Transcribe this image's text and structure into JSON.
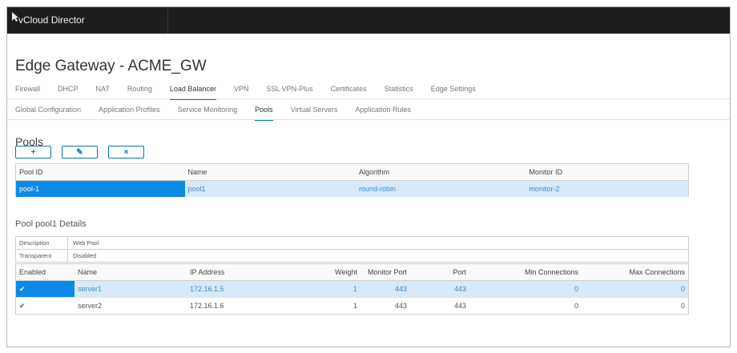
{
  "app": {
    "title": "vCloud Director"
  },
  "page": {
    "title": "Edge Gateway - ACME_GW"
  },
  "tabs": [
    {
      "label": "Firewall",
      "active": false
    },
    {
      "label": "DHCP",
      "active": false
    },
    {
      "label": "NAT",
      "active": false
    },
    {
      "label": "Routing",
      "active": false
    },
    {
      "label": "Load Balancer",
      "active": true
    },
    {
      "label": "VPN",
      "active": false
    },
    {
      "label": "SSL VPN-Plus",
      "active": false
    },
    {
      "label": "Certificates",
      "active": false
    },
    {
      "label": "Statistics",
      "active": false
    },
    {
      "label": "Edge Settings",
      "active": false
    }
  ],
  "subtabs": [
    {
      "label": "Global Configuration",
      "active": false
    },
    {
      "label": "Application Profiles",
      "active": false
    },
    {
      "label": "Service Monitoring",
      "active": false
    },
    {
      "label": "Pools",
      "active": true
    },
    {
      "label": "Virtual Servers",
      "active": false
    },
    {
      "label": "Application Rules",
      "active": false
    }
  ],
  "pools": {
    "title": "Pools",
    "buttons": {
      "add": "+",
      "edit": "✎",
      "delete": "×"
    },
    "columns": [
      "Pool ID",
      "Name",
      "Algorithm",
      "Monitor ID"
    ],
    "rows": [
      {
        "pool_id": "pool-1",
        "name": "pool1",
        "algorithm": "round-robin",
        "monitor_id": "monitor-2"
      }
    ]
  },
  "details": {
    "title": "Pool pool1 Details",
    "description_label": "Description",
    "description_value": "Web Pool",
    "transparent_label": "Transparent",
    "transparent_value": "Disabled",
    "columns": [
      "Enabled",
      "Name",
      "IP Address",
      "Weight",
      "Monitor Port",
      "Port",
      "Min Connections",
      "Max Connections"
    ],
    "rows": [
      {
        "enabled": "✔",
        "name": "server1",
        "ip": "172.16.1.5",
        "weight": "1",
        "monitor_port": "443",
        "port": "443",
        "min": "0",
        "max": "0"
      },
      {
        "enabled": "✔",
        "name": "server2",
        "ip": "172.16.1.6",
        "weight": "1",
        "monitor_port": "443",
        "port": "443",
        "min": "0",
        "max": "0"
      }
    ]
  },
  "colors": {
    "accent": "#0079b8",
    "selected": "#0b89e6",
    "row_highlight": "#d9e9f7",
    "topbar": "#1d1d1d"
  }
}
